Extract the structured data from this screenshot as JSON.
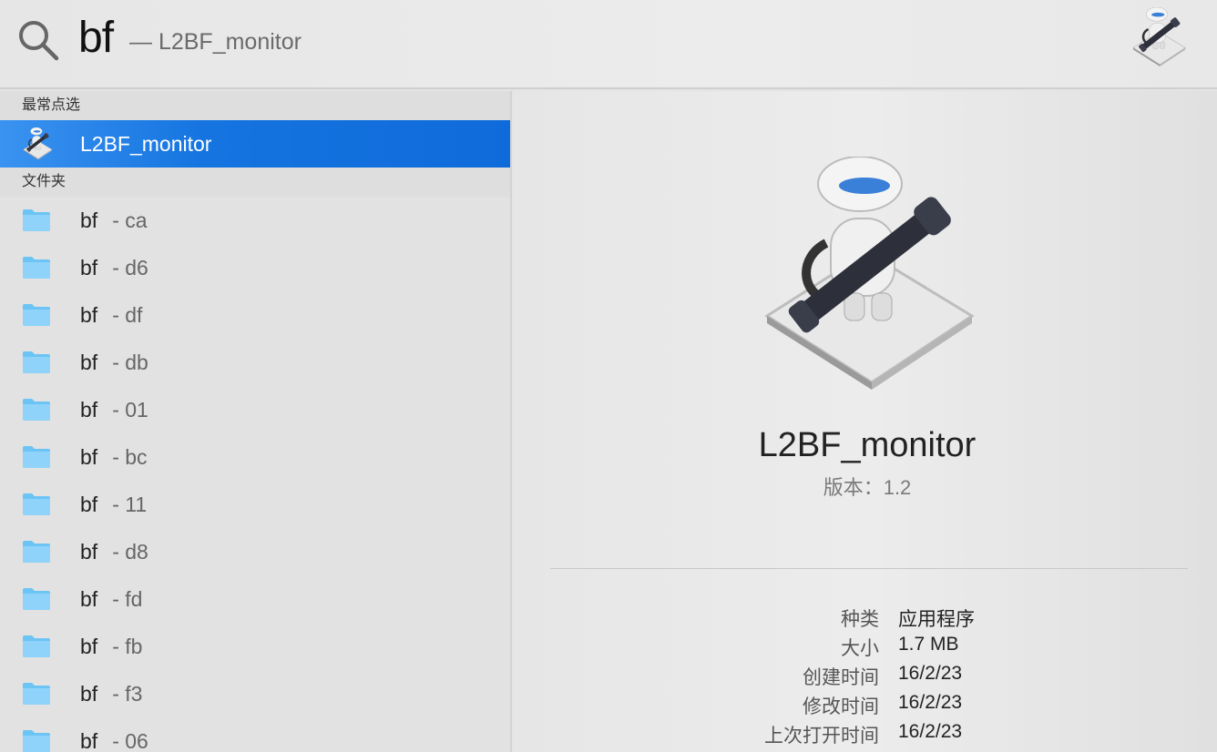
{
  "search": {
    "query": "bf",
    "completion": "— L2BF_monitor"
  },
  "results": {
    "top_hits_header": "最常点选",
    "top_hit": {
      "name": "L2BF_monitor",
      "icon": "automator-icon"
    },
    "folders_header": "文件夹",
    "folders": [
      {
        "name": "bf",
        "suffix": "- ca"
      },
      {
        "name": "bf",
        "suffix": "- d6"
      },
      {
        "name": "bf",
        "suffix": "- df"
      },
      {
        "name": "bf",
        "suffix": "- db"
      },
      {
        "name": "bf",
        "suffix": "- 01"
      },
      {
        "name": "bf",
        "suffix": "- bc"
      },
      {
        "name": "bf",
        "suffix": "- 11"
      },
      {
        "name": "bf",
        "suffix": "- d8"
      },
      {
        "name": "bf",
        "suffix": "- fd"
      },
      {
        "name": "bf",
        "suffix": "- fb"
      },
      {
        "name": "bf",
        "suffix": "- f3"
      },
      {
        "name": "bf",
        "suffix": "- 06"
      }
    ]
  },
  "preview": {
    "title": "L2BF_monitor",
    "version": "版本：1.2",
    "info": [
      {
        "label": "种类",
        "value": "应用程序"
      },
      {
        "label": "大小",
        "value": "1.7 MB"
      },
      {
        "label": "创建时间",
        "value": "16/2/23"
      },
      {
        "label": "修改时间",
        "value": "16/2/23"
      },
      {
        "label": "上次打开时间",
        "value": "16/2/23"
      }
    ]
  },
  "colors": {
    "selection": "#1574e0",
    "folder": "#6cc4f5"
  }
}
